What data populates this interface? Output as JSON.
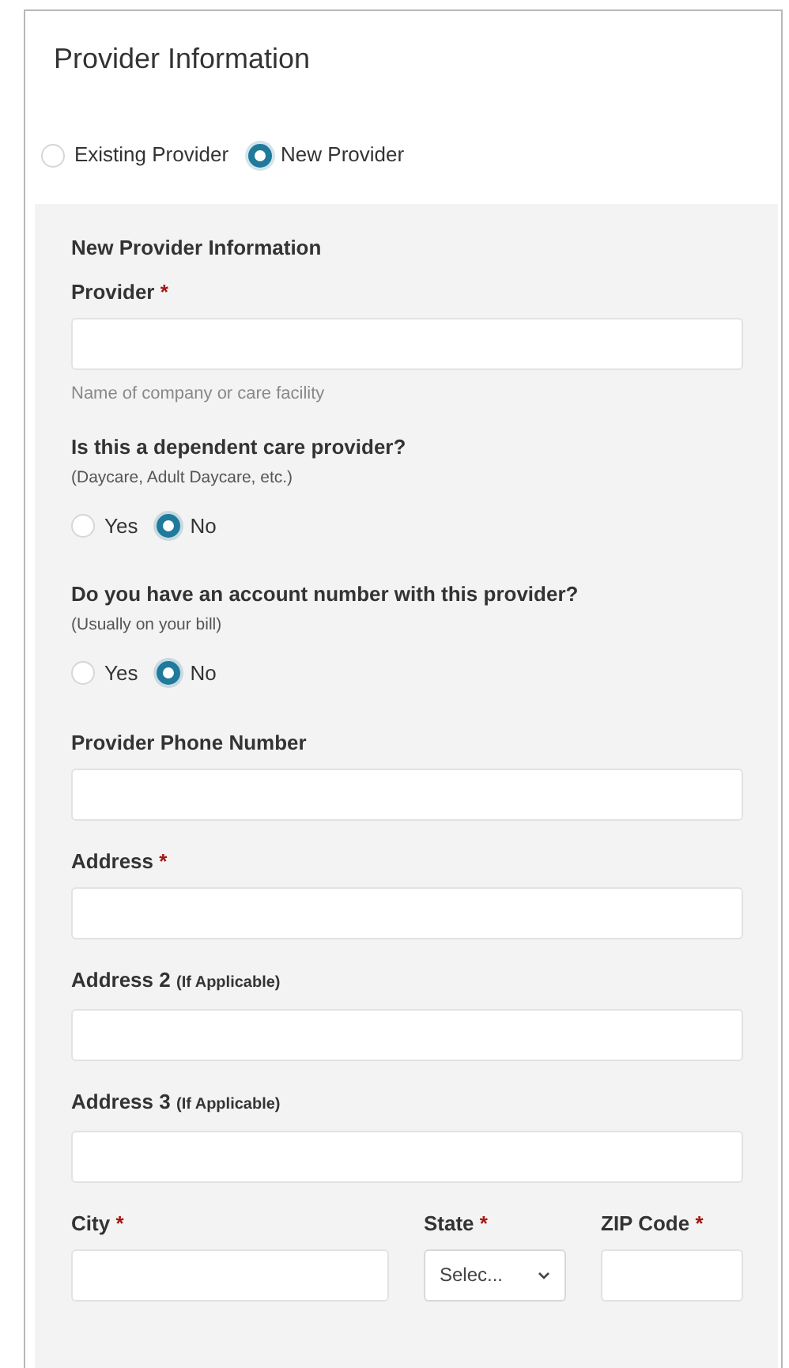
{
  "title": "Provider Information",
  "provider_type": [
    {
      "label": "Existing Provider",
      "selected": false
    },
    {
      "label": "New Provider",
      "selected": true
    }
  ],
  "section": {
    "heading": "New Provider Information",
    "items": [
      {
        "kind": "text",
        "label": "Provider",
        "required_mark": "*",
        "help": "Name of company or care facility"
      },
      {
        "kind": "choice",
        "label": "Is this a dependent care provider?",
        "hint": "(Daycare, Adult Daycare, etc.)",
        "options": [
          {
            "label": "Yes",
            "selected": false
          },
          {
            "label": "No",
            "selected": true
          }
        ]
      },
      {
        "kind": "choice",
        "label": "Do you have an account number with this provider?",
        "hint": "(Usually on your bill)",
        "options": [
          {
            "label": "Yes",
            "selected": false
          },
          {
            "label": "No",
            "selected": true
          }
        ]
      },
      {
        "kind": "text",
        "label": "Provider Phone Number"
      },
      {
        "kind": "text",
        "label": "Address",
        "required_mark": "*"
      },
      {
        "kind": "text",
        "label": "Address 2",
        "note": "(If Applicable)"
      },
      {
        "kind": "text",
        "label": "Address 3",
        "note": "(If Applicable)"
      },
      {
        "kind": "row",
        "fields": [
          {
            "kind": "text",
            "label": "City",
            "required_mark": "*"
          },
          {
            "kind": "select",
            "label": "State",
            "required_mark": "*",
            "value": "Selec..."
          },
          {
            "kind": "text",
            "label": "ZIP Code",
            "required_mark": "*"
          }
        ]
      }
    ]
  }
}
